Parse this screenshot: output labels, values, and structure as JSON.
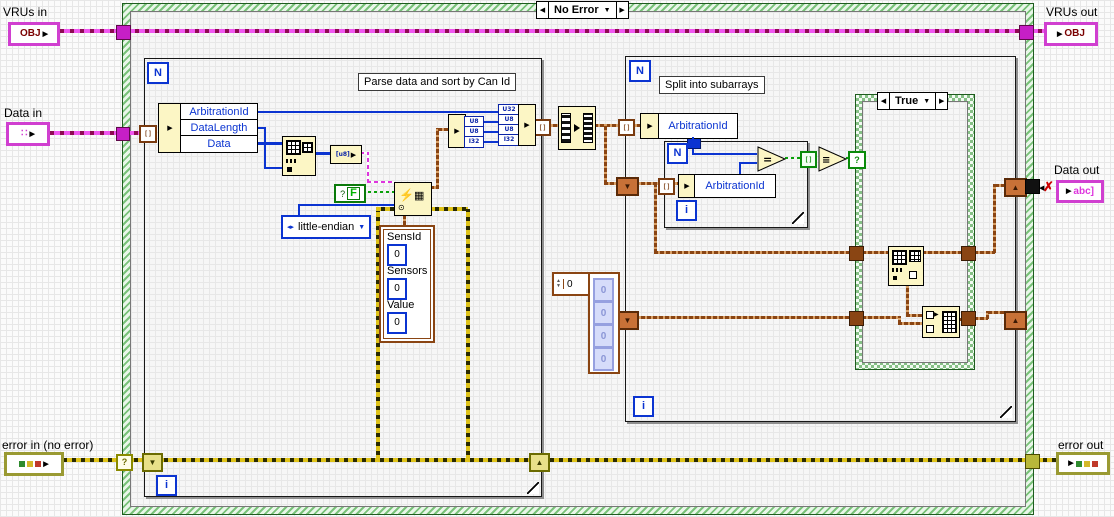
{
  "colors": {
    "object_wire": "#f057f0",
    "cluster_wire": "#8a4513",
    "numeric_wire": "#0b34d1",
    "boolean_wire": "#0aa10a",
    "error_wire": "#dfc318",
    "structure_green": "#79c279"
  },
  "glyphs": {
    "obj": "OBJ",
    "arrow": "▶",
    "arrow_left": "◀",
    "dropdown": "▼",
    "sr_up": "▲",
    "sr_down": "▼",
    "autoindex": "[ ]",
    "question": "?",
    "broken_x": "✗",
    "data_in_pattern": "∷",
    "abc": "abc]",
    "circle_dot": "⊙",
    "bolt": "⚡",
    "grid": "▦",
    "enum_glyph": "◂▸",
    "u8": "[u8]",
    "equals": "=",
    "and_glyph": "≡"
  },
  "terminals": {
    "vrus_in": {
      "label": "VRUs in"
    },
    "vrus_out": {
      "label": "VRUs out"
    },
    "data_in": {
      "label": "Data in"
    },
    "data_out": {
      "label": "Data out"
    },
    "error_in": {
      "label": "error in (no error)"
    },
    "error_out": {
      "label": "error out"
    }
  },
  "outer_case": {
    "selector": "No Error"
  },
  "loop1": {
    "n": "N",
    "i": "i",
    "comment": "Parse data and sort by Can Id",
    "unbundle_fields": [
      "ArbitrationId",
      "DataLength",
      "Data"
    ],
    "bool_const": {
      "q": "?",
      "value": "F"
    },
    "enum_const": "little-endian",
    "type_cluster": {
      "fields": [
        "SensId",
        "Sensors",
        "Value"
      ],
      "values": [
        "0",
        "0",
        "0"
      ]
    },
    "unbundle_cells": [
      "U8",
      "U8",
      "I32"
    ],
    "bundle_cells": [
      "U32",
      "U8",
      "U8",
      "I32"
    ]
  },
  "loop2": {
    "n": "N",
    "i": "i",
    "comment": "Split into subarrays",
    "unbundle_field": "ArbitrationId",
    "array_const": {
      "index": "0",
      "cells": [
        "0",
        "0",
        "0",
        "0"
      ]
    },
    "inner_loop": {
      "n": "N",
      "i": "i",
      "unbundle_field": "ArbitrationId"
    },
    "case_true": {
      "selector": "True"
    }
  }
}
